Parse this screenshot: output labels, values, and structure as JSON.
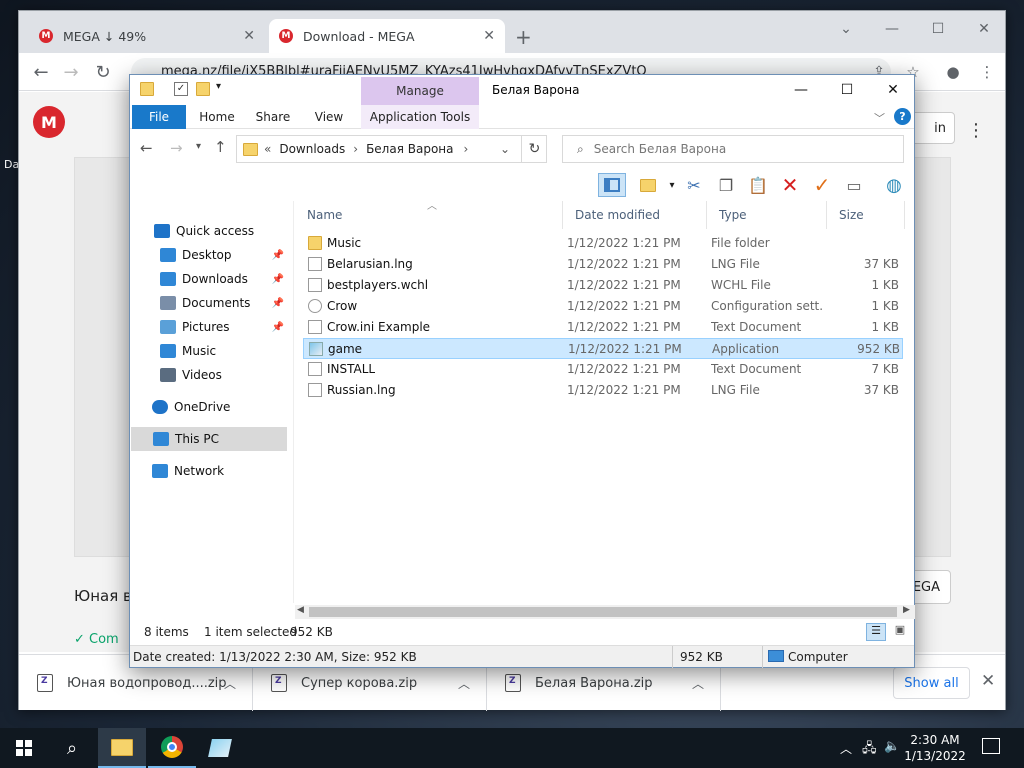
{
  "browser": {
    "tabs": [
      {
        "title": "MEGA ↓ 49%",
        "fav": "M"
      },
      {
        "title": "Download - MEGA",
        "fav": "M"
      }
    ],
    "url": "mega.nz/file/iX5BBlbl#uraFijAENvU5MZ_KYAzs41JwHvhqxDAfvvTnSExZVtQ",
    "page": {
      "title_fragment": "Юная во",
      "status_fragment": "Com",
      "signin_fragment": "in",
      "download_fragment": "EGA",
      "desktop_label": "Da"
    }
  },
  "downloads": {
    "items": [
      "Юная водопровод....zip",
      "Супер корова.zip",
      "Белая Варона.zip"
    ],
    "show_all": "Show all"
  },
  "explorer": {
    "title": "Белая Варона",
    "manage": "Manage",
    "ribbon_tabs": [
      "File",
      "Home",
      "Share",
      "View",
      "Application Tools"
    ],
    "breadcrumb": {
      "prefix": "«",
      "parts": [
        "Downloads",
        "Белая Варона"
      ]
    },
    "search_placeholder": "Search Белая Варона",
    "columns": [
      "Name",
      "Date modified",
      "Type",
      "Size"
    ],
    "nav": [
      {
        "label": "Quick access",
        "icon": "star-icon",
        "color": "#1e73c8"
      },
      {
        "label": "Desktop",
        "icon": "desktop-icon",
        "color": "#2f87d6",
        "pinned": true
      },
      {
        "label": "Downloads",
        "icon": "download-arrow-icon",
        "color": "#2f87d6",
        "pinned": true
      },
      {
        "label": "Documents",
        "icon": "documents-icon",
        "color": "#7a8ea8",
        "pinned": true
      },
      {
        "label": "Pictures",
        "icon": "pictures-icon",
        "color": "#5aa0d8",
        "pinned": true
      },
      {
        "label": "Music",
        "icon": "music-note-icon",
        "color": "#2f87d6"
      },
      {
        "label": "Videos",
        "icon": "videos-icon",
        "color": "#5a6c80"
      },
      {
        "label": "OneDrive",
        "icon": "cloud-icon",
        "color": "#1e73c8"
      },
      {
        "label": "This PC",
        "icon": "computer-icon",
        "color": "#2f87d6",
        "selected": true
      },
      {
        "label": "Network",
        "icon": "network-icon",
        "color": "#2f87d6"
      }
    ],
    "files": [
      {
        "name": "Music",
        "date": "1/12/2022 1:21 PM",
        "type": "File folder",
        "size": "",
        "icon": "folder-icon"
      },
      {
        "name": "Belarusian.lng",
        "date": "1/12/2022 1:21 PM",
        "type": "LNG File",
        "size": "37 KB",
        "icon": "document-icon"
      },
      {
        "name": "bestplayers.wchl",
        "date": "1/12/2022 1:21 PM",
        "type": "WCHL File",
        "size": "1 KB",
        "icon": "document-icon"
      },
      {
        "name": "Crow",
        "date": "1/12/2022 1:21 PM",
        "type": "Configuration sett...",
        "size": "1 KB",
        "icon": "settings-file-icon"
      },
      {
        "name": "Crow.ini Example",
        "date": "1/12/2022 1:21 PM",
        "type": "Text Document",
        "size": "1 KB",
        "icon": "document-icon"
      },
      {
        "name": "game",
        "date": "1/12/2022 1:21 PM",
        "type": "Application",
        "size": "952 KB",
        "icon": "application-icon",
        "selected": true
      },
      {
        "name": "INSTALL",
        "date": "1/12/2022 1:21 PM",
        "type": "Text Document",
        "size": "7 KB",
        "icon": "document-icon"
      },
      {
        "name": "Russian.lng",
        "date": "1/12/2022 1:21 PM",
        "type": "LNG File",
        "size": "37 KB",
        "icon": "document-icon"
      }
    ],
    "status": {
      "count": "8 items",
      "selected": "1 item selected",
      "size": "952 KB"
    },
    "details": {
      "text": "Date created: 1/13/2022 2:30 AM, Size: 952 KB",
      "size": "952 KB",
      "location": "Computer"
    }
  },
  "taskbar": {
    "time": "2:30 AM",
    "date": "1/13/2022"
  }
}
